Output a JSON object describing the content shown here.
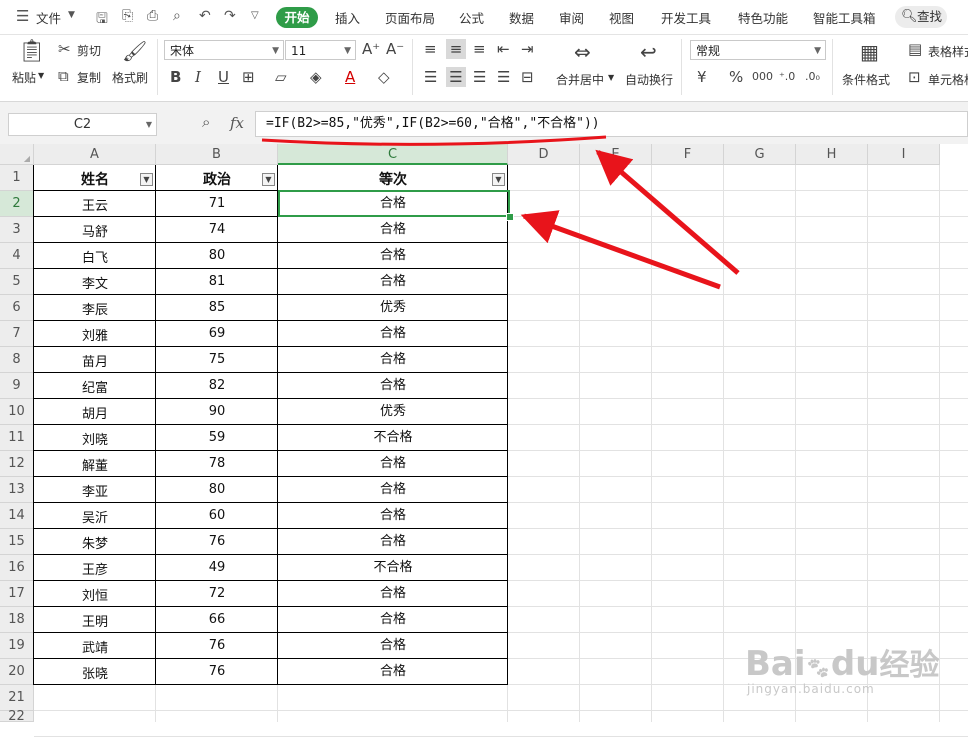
{
  "menu": {
    "file_label": "文件",
    "tabs": [
      "开始",
      "插入",
      "页面布局",
      "公式",
      "数据",
      "审阅",
      "视图",
      "开发工具",
      "特色功能",
      "智能工具箱"
    ],
    "active_tab": "开始",
    "search_label": "查找"
  },
  "ribbon": {
    "paste": "粘贴",
    "cut": "剪切",
    "copy": "复制",
    "format_painter": "格式刷",
    "font_name": "宋体",
    "font_size": "11",
    "merge_center": "合并居中",
    "wrap_text": "自动换行",
    "number_format": "常规",
    "conditional_format": "条件格式",
    "table_style": "表格样式",
    "cell_format": "单元格格式"
  },
  "formula_bar": {
    "name_box": "C2",
    "fx_label": "fx",
    "formula": "=IF(B2>=85,\"优秀\",IF(B2>=60,\"合格\",\"不合格\"))"
  },
  "sheet": {
    "columns": [
      "A",
      "B",
      "C",
      "D",
      "E",
      "F",
      "G",
      "H",
      "I"
    ],
    "row_numbers": [
      "1",
      "2",
      "3",
      "4",
      "5",
      "6",
      "7",
      "8",
      "9",
      "10",
      "11",
      "12",
      "13",
      "14",
      "15",
      "16",
      "17",
      "18",
      "19",
      "20",
      "21",
      "22"
    ],
    "headers": [
      "姓名",
      "政治",
      "等次"
    ],
    "rows": [
      [
        "王云",
        "71",
        "合格"
      ],
      [
        "马舒",
        "74",
        "合格"
      ],
      [
        "白飞",
        "80",
        "合格"
      ],
      [
        "李文",
        "81",
        "合格"
      ],
      [
        "李辰",
        "85",
        "优秀"
      ],
      [
        "刘雅",
        "69",
        "合格"
      ],
      [
        "苗月",
        "75",
        "合格"
      ],
      [
        "纪富",
        "82",
        "合格"
      ],
      [
        "胡月",
        "90",
        "优秀"
      ],
      [
        "刘晓",
        "59",
        "不合格"
      ],
      [
        "解董",
        "78",
        "合格"
      ],
      [
        "李亚",
        "80",
        "合格"
      ],
      [
        "吴沂",
        "60",
        "合格"
      ],
      [
        "朱梦",
        "76",
        "合格"
      ],
      [
        "王彦",
        "49",
        "不合格"
      ],
      [
        "刘恒",
        "72",
        "合格"
      ],
      [
        "王明",
        "66",
        "合格"
      ],
      [
        "武靖",
        "76",
        "合格"
      ],
      [
        "张晓",
        "76",
        "合格"
      ]
    ],
    "active_cell": "C2"
  },
  "colors": {
    "accent_green": "#2f9c48",
    "annotation_red": "#e8141b"
  },
  "watermark": {
    "brand": "Bai",
    "brand2": "du",
    "cn": "经验",
    "url": "jingyan.baidu.com"
  }
}
